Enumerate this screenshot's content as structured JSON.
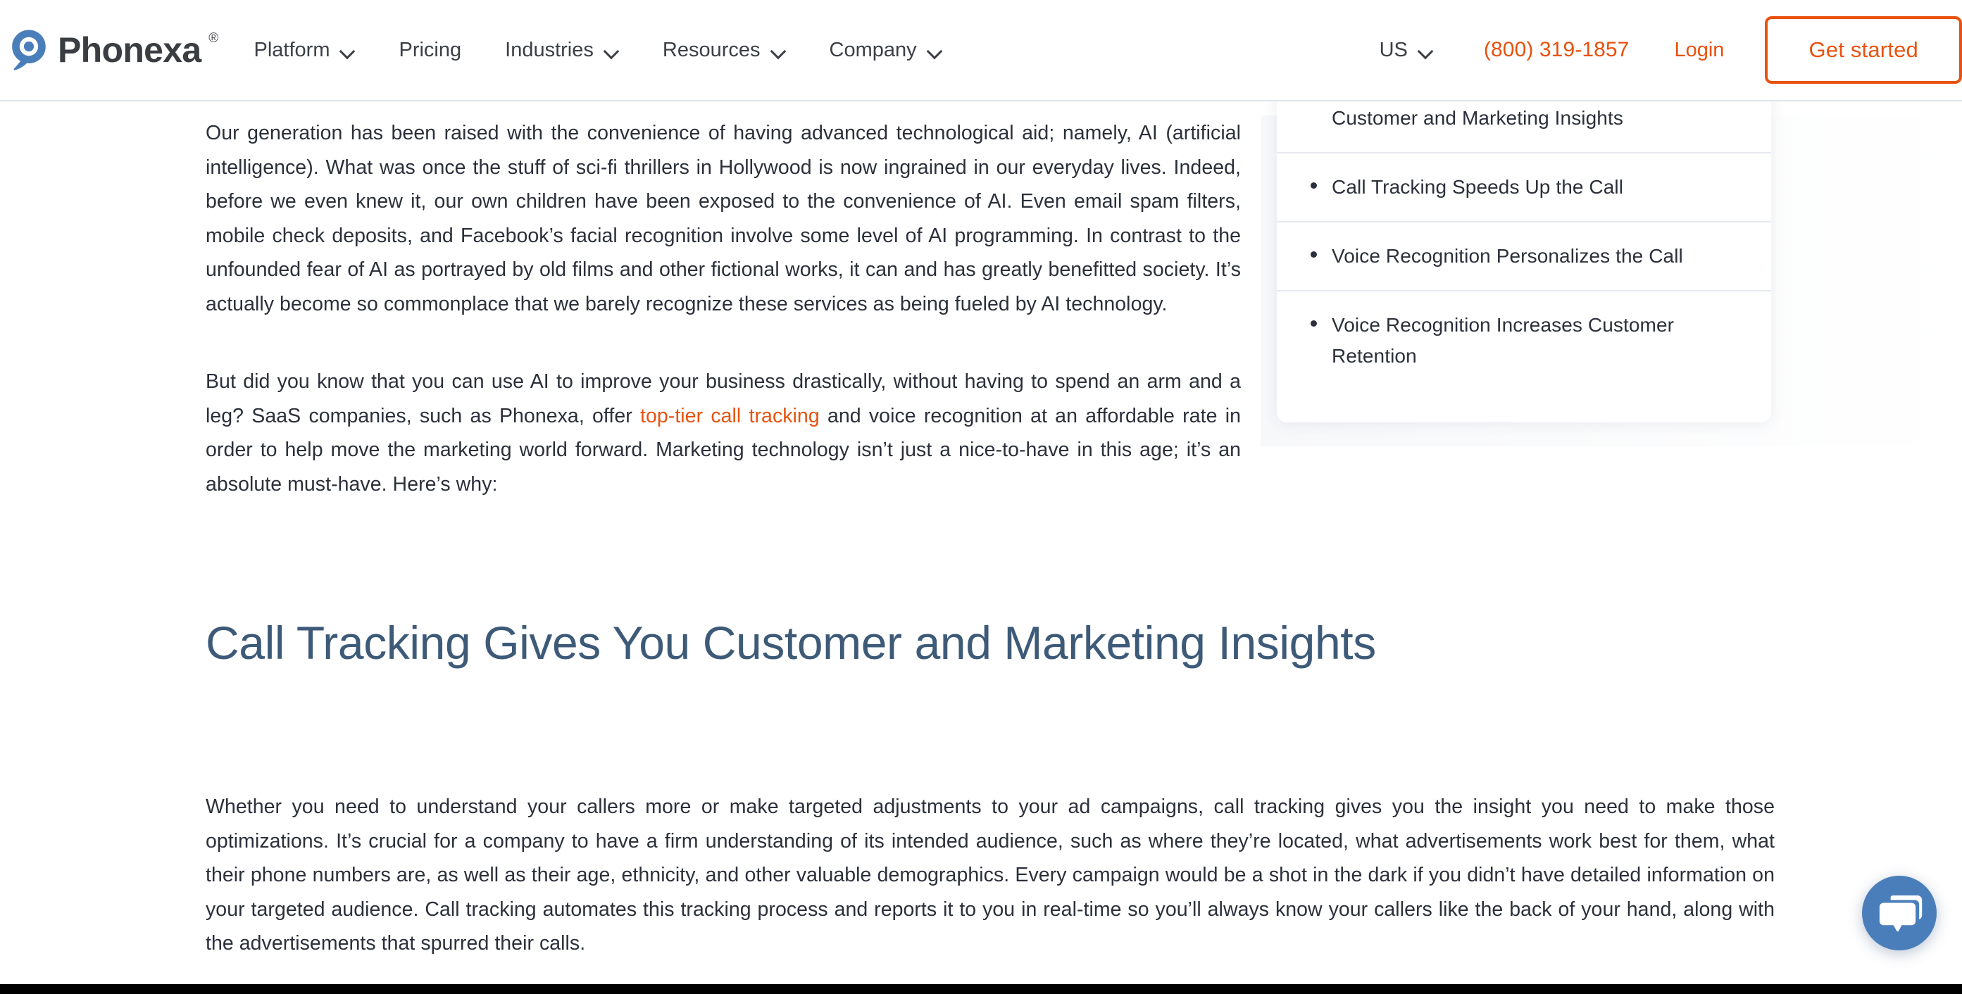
{
  "colors": {
    "brand_orange": "#e8520f",
    "heading_blue": "#3d5a78",
    "body_text": "#2b303b",
    "logo_blue": "#4a7ebb",
    "chat_blue": "#4a7ebb",
    "header_border": "#dde3ec",
    "toc_divider": "#e7e9f2"
  },
  "header": {
    "brand_name": "Phonexa",
    "brand_trademark": "®",
    "logo_icon": "phonexa-pin-logo-icon",
    "nav": [
      {
        "label": "Platform",
        "has_dropdown": true
      },
      {
        "label": "Pricing",
        "has_dropdown": false
      },
      {
        "label": "Industries",
        "has_dropdown": true
      },
      {
        "label": "Resources",
        "has_dropdown": true
      },
      {
        "label": "Company",
        "has_dropdown": true
      }
    ],
    "locale": {
      "label": "US",
      "has_dropdown": true
    },
    "phone": "(800) 319-1857",
    "login_label": "Login",
    "cta_label": "Get started"
  },
  "article": {
    "paragraph_1": "Our generation has been raised with the convenience of having advanced technological aid; namely, AI (artificial intelligence). What was once the stuff of sci-fi thrillers in Hollywood is now ingrained in our everyday lives. Indeed, before we even knew it, our own children have been exposed to the convenience of AI. Even email spam filters, mobile check deposits, and Facebook’s facial recognition involve some level of AI programming. In contrast to the unfounded fear of AI as portrayed by old films and other fictional works, it can and has greatly benefitted society. It’s actually become so commonplace that we barely recognize these services as being fueled by AI technology.",
    "paragraph_2_part1": "But did you know that you can use AI to improve your business drastically, without having to spend an arm and a leg? SaaS companies, such as Phonexa, offer ",
    "paragraph_2_link": "top-tier call tracking",
    "paragraph_2_part2": " and voice recognition at an affordable rate in order to help move the marketing world forward. Marketing technology isn’t just a nice-to-have in this age; it’s an absolute must-have. Here’s why:",
    "section_heading": "Call Tracking Gives You Customer and Marketing Insights",
    "paragraph_3": "Whether you need to understand your callers more or make targeted adjustments to your ad campaigns, call tracking gives you the insight you need to make those optimizations. It’s crucial for a company to have a firm understanding of its intended audience, such as where they’re located, what advertisements work best for them, what their phone numbers are, as well as their age, ethnicity, and other valuable demographics. Every campaign would be a shot in the dark if you didn’t have detailed information on your targeted audience. Call tracking automates this tracking process and reports it to you in real-time so you’ll always know your callers like the back of your hand, along with the advertisements that spurred their calls."
  },
  "toc": {
    "items": [
      {
        "label": "Customer and Marketing Insights",
        "show_bullet": false
      },
      {
        "label": "Call Tracking Speeds Up the Call",
        "show_bullet": true
      },
      {
        "label": "Voice Recognition Personalizes the Call",
        "show_bullet": true
      },
      {
        "label": "Voice Recognition Increases Customer Retention",
        "show_bullet": true
      }
    ]
  },
  "chat": {
    "icon": "chat-bubbles-icon"
  }
}
